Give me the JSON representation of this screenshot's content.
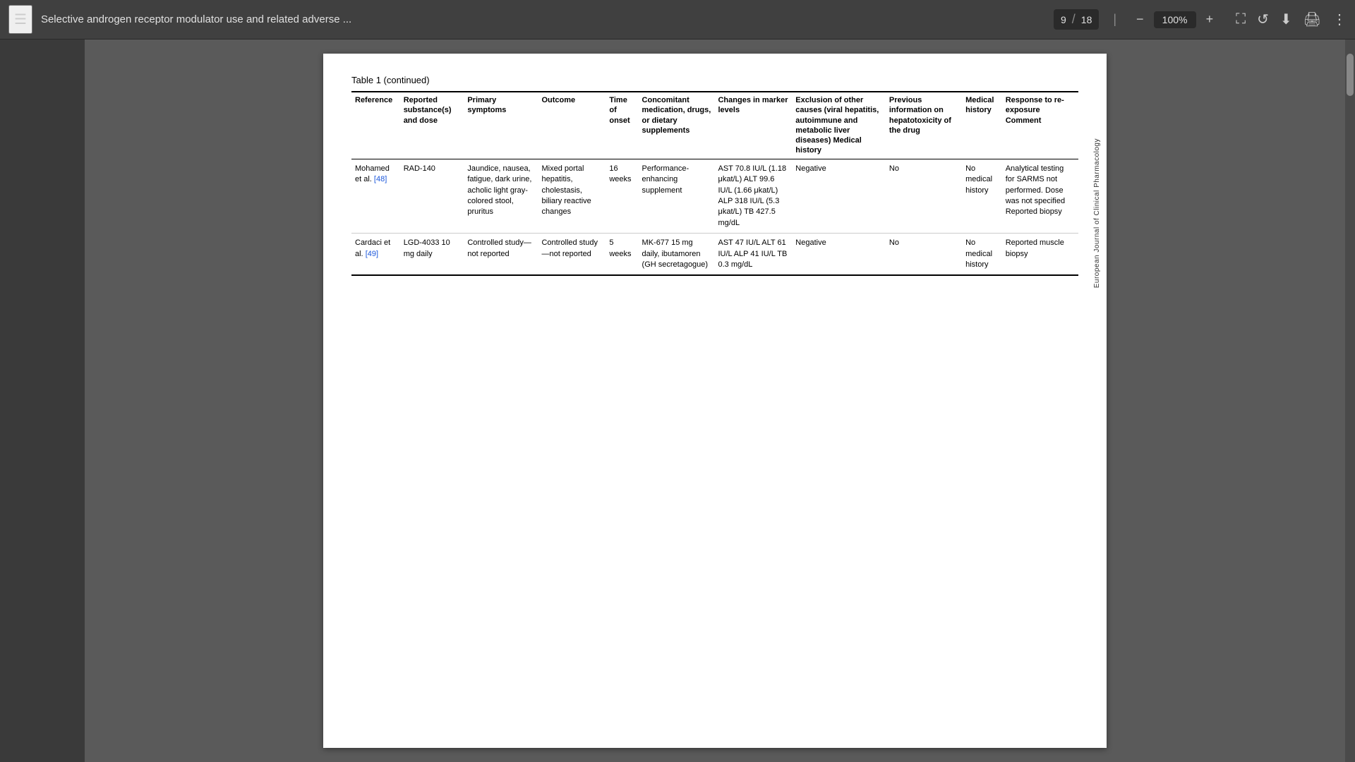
{
  "toolbar": {
    "menu_label": "☰",
    "title": "Selective androgen receptor modulator use and related adverse ...",
    "page_current": "9",
    "page_total": "18",
    "zoom": "100%",
    "download_icon": "⬇",
    "print_icon": "🖨",
    "more_icon": "⋮",
    "zoom_out": "−",
    "zoom_in": "+",
    "fit_icon": "⛶",
    "history_icon": "🕐"
  },
  "table": {
    "caption": "Table 1",
    "caption_note": "(continued)",
    "columns": [
      "Reference",
      "Reported substance(s) and dose",
      "Primary symptoms",
      "Outcome",
      "Time of onset",
      "Concomitant medication, drugs, or dietary supplements",
      "Changes in marker levels",
      "Exclusion of other causes (viral hepatitis, autoimmune and metabolic liver diseases) Medical history",
      "Previous information on hepatotoxicity of the drug",
      "Medical history",
      "Response to re-exposure Comment"
    ],
    "rows": [
      {
        "reference": "Mohamed et al. [48]",
        "reference_link": "[48]",
        "substance": "RAD-140",
        "symptoms": "Jaundice, nausea, fatigue, dark urine, acholic light gray-colored stool, pruritus",
        "outcome": "Mixed portal hepatitis, cholestasis, biliary reactive changes",
        "time_of_onset": "16 weeks",
        "concomitant": "Performance-enhancing supplement",
        "marker_levels": "AST 70.8 IU/L (1.18 μkat/L) ALT 99.6 IU/L (1.66 μkat/L) ALP 318 IU/L (5.3 μkat/L) TB 427.5 mg/dL",
        "exclusion": "Negative",
        "previous_info": "No",
        "medical_history": "No medical history",
        "response": "Analytical testing for SARMS not performed. Dose was not specified Reported biopsy"
      },
      {
        "reference": "Cardaci et al. [49]",
        "reference_link": "[49]",
        "substance": "LGD-4033 10 mg daily",
        "symptoms": "Controlled study—not reported",
        "outcome": "Controlled study—not reported",
        "time_of_onset": "5 weeks",
        "concomitant": "MK-677 15 mg daily, ibutamoren (GH secretagogue)",
        "marker_levels": "AST 47 IU/L ALT 61 IU/L ALP 41 IU/L TB 0.3 mg/dL",
        "exclusion": "Negative",
        "previous_info": "No",
        "medical_history": "No medical history",
        "response": "Reported muscle biopsy"
      }
    ]
  },
  "journal": {
    "name": "European Journal of Clinical Pharmacology"
  }
}
